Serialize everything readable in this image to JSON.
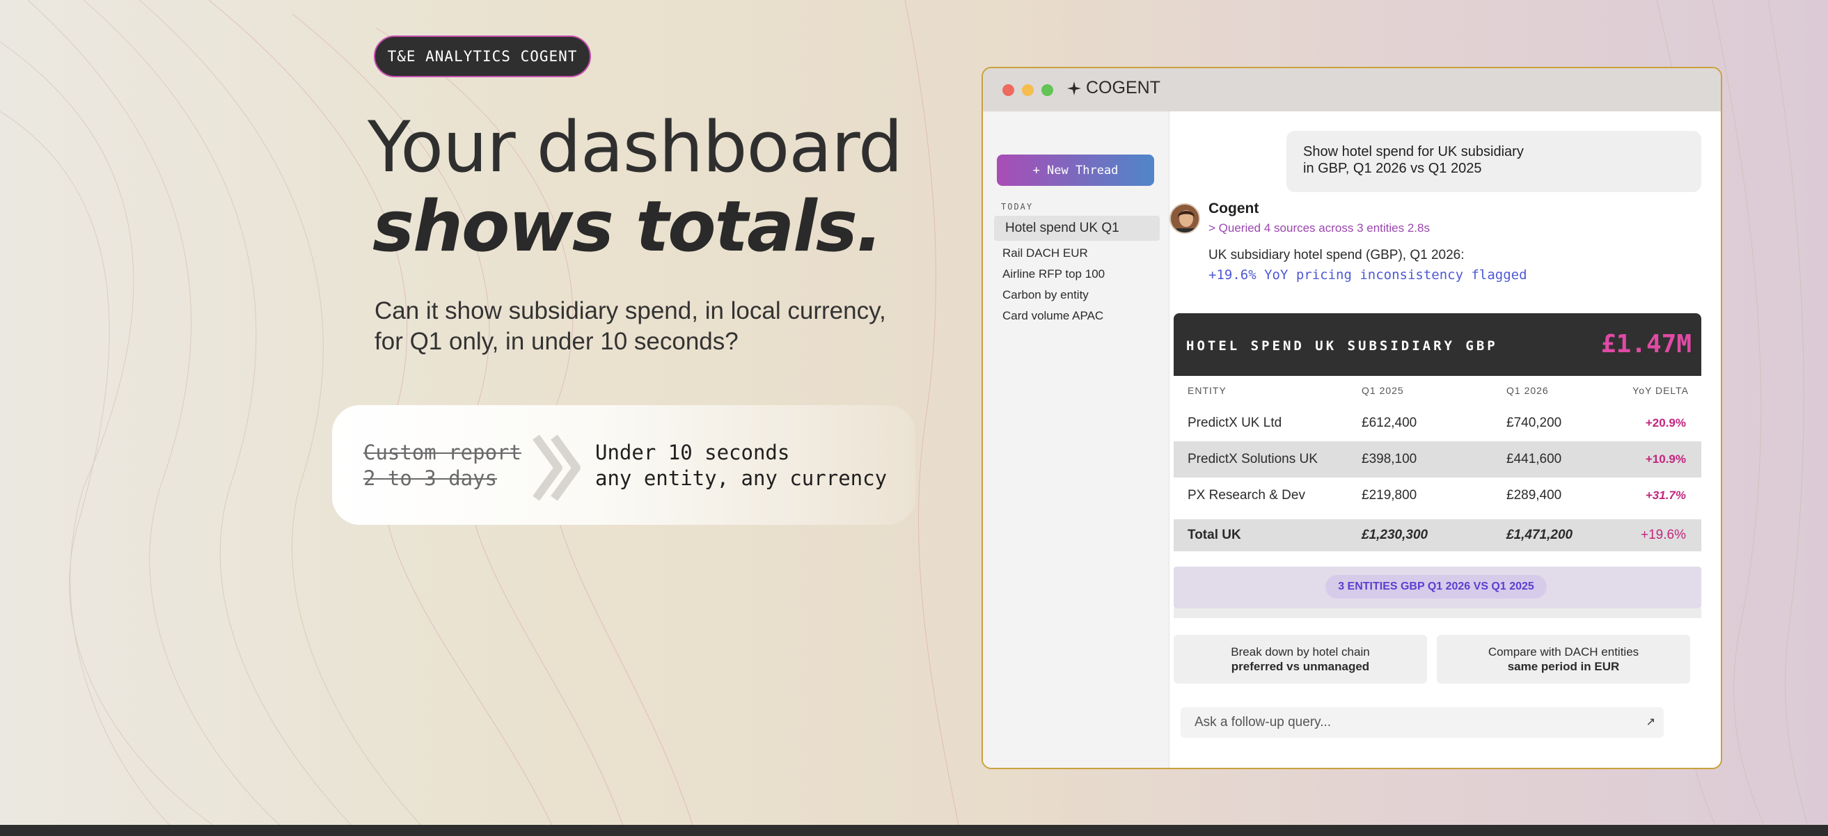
{
  "hero": {
    "tag": "T&E ANALYTICS COGENT",
    "headline_line1": "Your dashboard",
    "headline_line2": "shows totals.",
    "subhead": "Can it show subsidiary spend, in local currency, for Q1 only, in under 10 seconds?",
    "compare": {
      "old_line1": "Custom report",
      "old_line2": "2 to 3 days",
      "new_line1": "Under 10 seconds",
      "new_line2": "any entity, any currency"
    }
  },
  "app": {
    "brand": "COGENT",
    "brand_icon": "sparkle-icon",
    "window_dots": [
      "#ee6a5f",
      "#f5bd4f",
      "#61c454"
    ],
    "sidebar": {
      "new_thread": "+ New Thread",
      "section_label": "TODAY",
      "threads": [
        "Hotel spend UK Q1",
        "Rail DACH EUR",
        "Airline RFP top 100",
        "Carbon by entity",
        "Card volume APAC"
      ]
    },
    "user_message_line1": "Show hotel spend for UK subsidiary",
    "user_message_line2": "in GBP, Q1 2026 vs Q1 2025",
    "bot": {
      "name": "Cogent",
      "meta": "> Queried 4 sources across 3 entities 2.8s",
      "text": "UK subsidiary hotel spend (GBP), Q1 2026:",
      "highlight": "+19.6% YoY pricing inconsistency flagged"
    },
    "result": {
      "title": "HOTEL SPEND UK SUBSIDIARY GBP",
      "total_value": "£1.47M",
      "columns": [
        "ENTITY",
        "Q1 2025",
        "Q1 2026",
        "YoY DELTA"
      ],
      "rows": [
        {
          "entity": "PredictX UK Ltd",
          "q1_2025": "£612,400",
          "q1_2026": "£740,200",
          "delta": "+20.9%"
        },
        {
          "entity": "PredictX Solutions UK",
          "q1_2025": "£398,100",
          "q1_2026": "£441,600",
          "delta": "+10.9%"
        },
        {
          "entity": "PX Research & Dev",
          "q1_2025": "£219,800",
          "q1_2026": "£289,400",
          "delta": "+31.7%"
        }
      ],
      "total_row": {
        "entity": "Total UK",
        "q1_2025": "£1,230,300",
        "q1_2026": "£1,471,200",
        "delta": "+19.6%"
      },
      "summary": "3 ENTITIES GBP Q1 2026 VS Q1 2025"
    },
    "suggestions": [
      {
        "line1": "Break down by hotel chain",
        "line2": "preferred vs unmanaged"
      },
      {
        "line1": "Compare with DACH entities",
        "line2": "same period in EUR"
      }
    ],
    "followup_placeholder": "Ask a follow-up query...",
    "send_icon": "arrow-up-right-icon"
  }
}
